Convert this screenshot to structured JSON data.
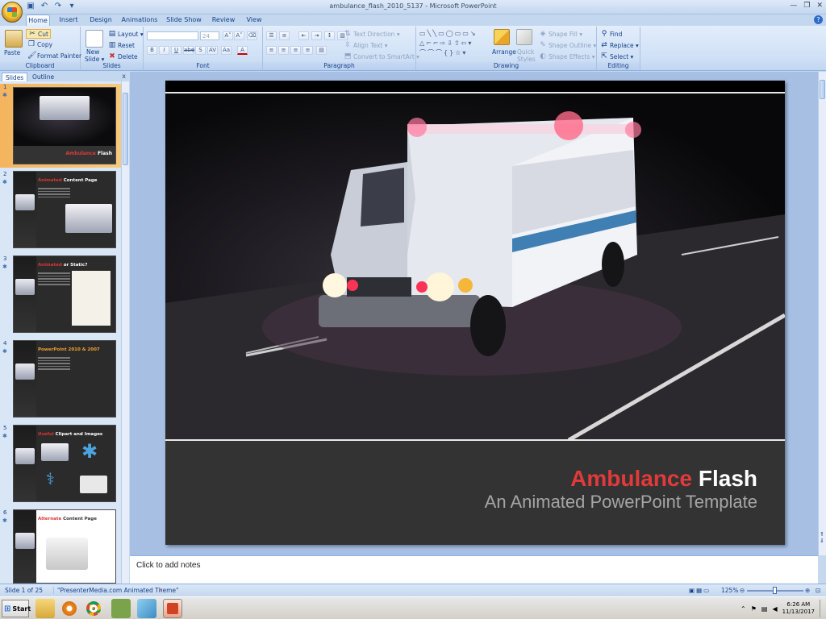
{
  "window": {
    "title": "ambulance_flash_2010_5137 - Microsoft PowerPoint",
    "minimize": "—",
    "restore": "❐",
    "close": "✕"
  },
  "qat": {
    "save_icon": "save-icon",
    "undo_icon": "undo-icon",
    "redo_icon": "redo-icon"
  },
  "tabs": [
    "Home",
    "Insert",
    "Design",
    "Animations",
    "Slide Show",
    "Review",
    "View"
  ],
  "active_tab": "Home",
  "help_icon": "?",
  "ribbon": {
    "clipboard": {
      "label": "Clipboard",
      "paste": "Paste",
      "cut": "Cut",
      "copy": "Copy",
      "format_painter": "Format Painter"
    },
    "slides": {
      "label": "Slides",
      "new_slide": "New",
      "new_slide2": "Slide ▾",
      "layout": "Layout ▾",
      "reset": "Reset",
      "delete": "Delete"
    },
    "font": {
      "label": "Font",
      "font_name": "",
      "font_size": "24",
      "bold": "B",
      "italic": "I",
      "underline": "U",
      "strike": "abe",
      "shadow": "S",
      "spacing": "AV",
      "case": "Aa",
      "color": "A"
    },
    "paragraph": {
      "label": "Paragraph",
      "text_direction": "Text Direction ▾",
      "align_text": "Align Text ▾",
      "convert_smartart": "Convert to SmartArt ▾"
    },
    "drawing": {
      "label": "Drawing",
      "arrange": "Arrange",
      "quick_styles": "Quick Styles",
      "shape_fill": "Shape Fill ▾",
      "shape_outline": "Shape Outline ▾",
      "shape_effects": "Shape Effects ▾"
    },
    "editing": {
      "label": "Editing",
      "find": "Find",
      "replace": "Replace ▾",
      "select": "Select ▾"
    }
  },
  "pane": {
    "tab_slides": "Slides",
    "tab_outline": "Outline",
    "close": "x",
    "thumbnails": [
      {
        "num": "1",
        "title_red": "Ambulance",
        "title_white": " Flash"
      },
      {
        "num": "2",
        "title_red": "Animated",
        "title_white": " Content Page"
      },
      {
        "num": "3",
        "title_red": "Animated",
        "title_white": " or Static?"
      },
      {
        "num": "4",
        "title_red": "",
        "title_white": "PowerPoint 2010 & 2007"
      },
      {
        "num": "5",
        "title_red": "Useful",
        "title_white": " Clipart and Images"
      },
      {
        "num": "6",
        "title_red": "Alternate",
        "title_white": " Content Page"
      }
    ]
  },
  "slide": {
    "title_red": "Ambulance",
    "title_white": "Flash",
    "subtitle": "An Animated PowerPoint Template"
  },
  "notes_placeholder": "Click to add notes",
  "status": {
    "slide_count": "Slide 1 of 25",
    "theme": "\"PresenterMedia.com Animated Theme\"",
    "zoom": "125%"
  },
  "taskbar": {
    "start": "Start",
    "time": "6:26 AM",
    "date": "11/13/2017"
  }
}
